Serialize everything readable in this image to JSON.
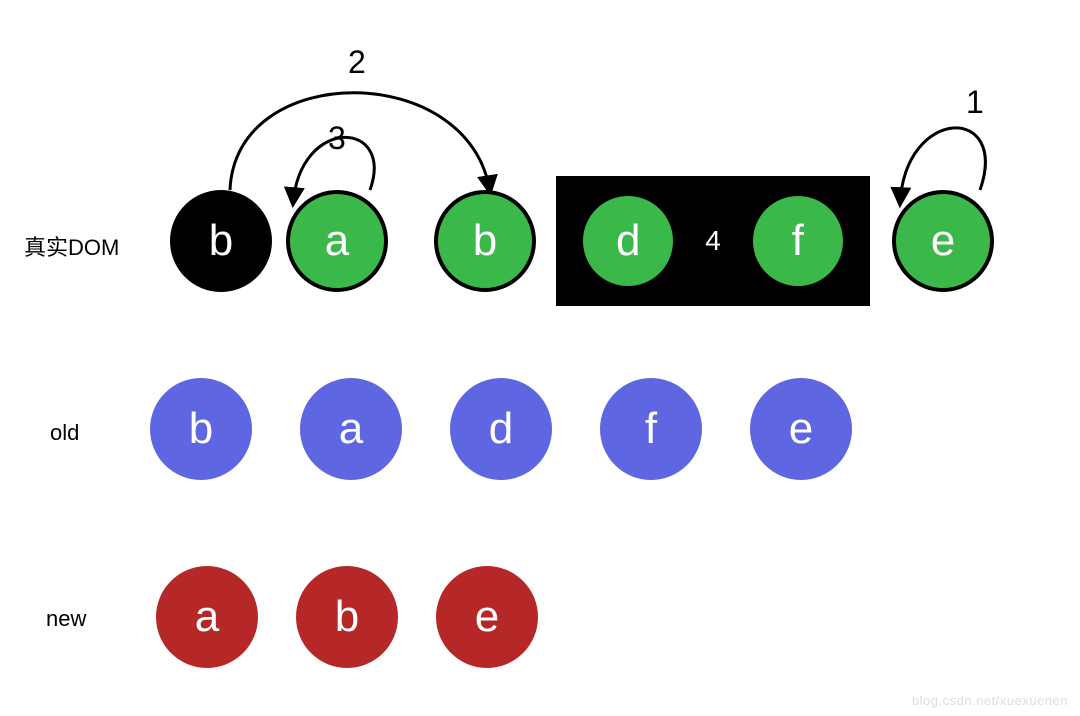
{
  "labels": {
    "row1": "真实DOM",
    "row2": "old",
    "row3": "new"
  },
  "row1": {
    "n0": "b",
    "n1": "a",
    "n2": "b",
    "box_left": "d",
    "box_mid": "4",
    "box_right": "f",
    "n_last": "e"
  },
  "row2": {
    "c0": "b",
    "c1": "a",
    "c2": "d",
    "c3": "f",
    "c4": "e"
  },
  "row3": {
    "c0": "a",
    "c1": "b",
    "c2": "e"
  },
  "anno": {
    "a1": "1",
    "a2": "2",
    "a3": "3"
  },
  "watermark": "blog.csdn.net/xuexuenen",
  "chart_data": {
    "type": "diagram",
    "title": "DOM diff / reorder illustration",
    "rows": [
      {
        "name": "真实DOM",
        "nodes": [
          "b",
          "a",
          "b",
          "d",
          "f",
          "e"
        ],
        "boxed_group": {
          "labels": [
            "d",
            "f"
          ],
          "center_text": "4"
        }
      },
      {
        "name": "old",
        "nodes": [
          "b",
          "a",
          "d",
          "f",
          "e"
        ]
      },
      {
        "name": "new",
        "nodes": [
          "a",
          "b",
          "e"
        ]
      }
    ],
    "arrows": [
      {
        "id": 1,
        "from": "row1.e",
        "to": "row1.e",
        "kind": "self-loop"
      },
      {
        "id": 2,
        "from": "row1.b(black)",
        "to": "row1.b(green)",
        "kind": "move"
      },
      {
        "id": 3,
        "from": "row1.a",
        "to": "row1.a",
        "kind": "self-loop"
      }
    ],
    "colors": {
      "green": "#3ab94a",
      "blue": "#5f66e2",
      "red": "#b62727",
      "black": "#000000"
    }
  }
}
